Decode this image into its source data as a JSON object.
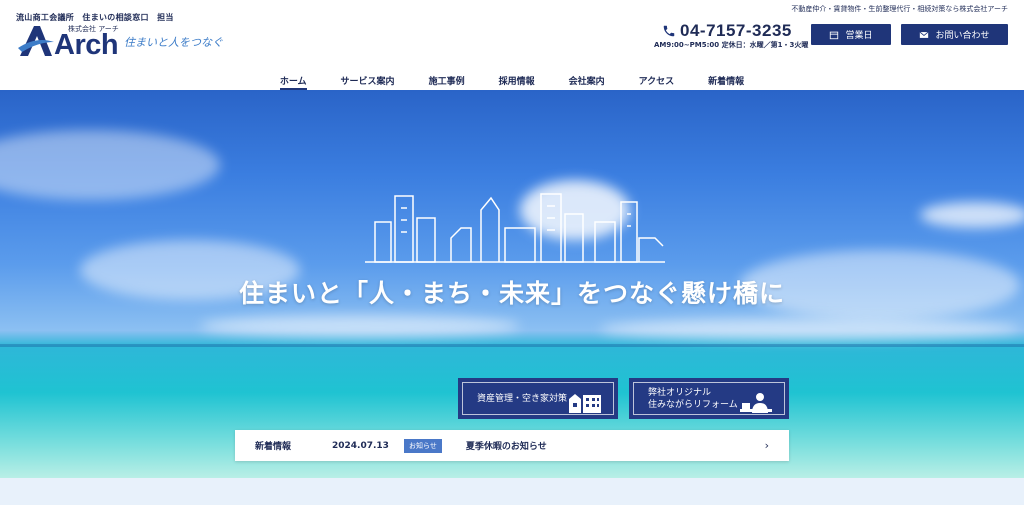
{
  "header": {
    "tagline_left": "流山商工会議所　住まいの相談窓口　担当",
    "company_small": "株式会社 アーチ",
    "logo_letter": "A",
    "logo_word": "Arch",
    "logo_catch": "住まいと人をつなぐ",
    "tagline_right": "不動産仲介・賃貸物件・生前整理代行・相続対策なら株式会社アーチ",
    "phone": "04-7157-3235",
    "hours": "AM9:00~PM5:00 定休日：水曜／第1・3火曜",
    "hours_button": "営業日",
    "contact_button": "お問い合わせ"
  },
  "nav": {
    "items": [
      "ホーム",
      "サービス案内",
      "施工事例",
      "採用情報",
      "会社案内",
      "アクセス",
      "新着情報"
    ]
  },
  "hero": {
    "title": "住まいと「人・まち・未来」をつなぐ懸け橋に",
    "feature1": "資産管理・空き家対策",
    "feature2_line1": "弊社オリジナル",
    "feature2_line2": "住みながらリフォーム"
  },
  "news": {
    "label": "新着情報",
    "date": "2024.07.13",
    "badge": "お知らせ",
    "title": "夏季休暇のお知らせ",
    "arrow": "›"
  },
  "colors": {
    "brand": "#1f3579",
    "text": "#1f2b56",
    "badge": "#4a78c8"
  }
}
